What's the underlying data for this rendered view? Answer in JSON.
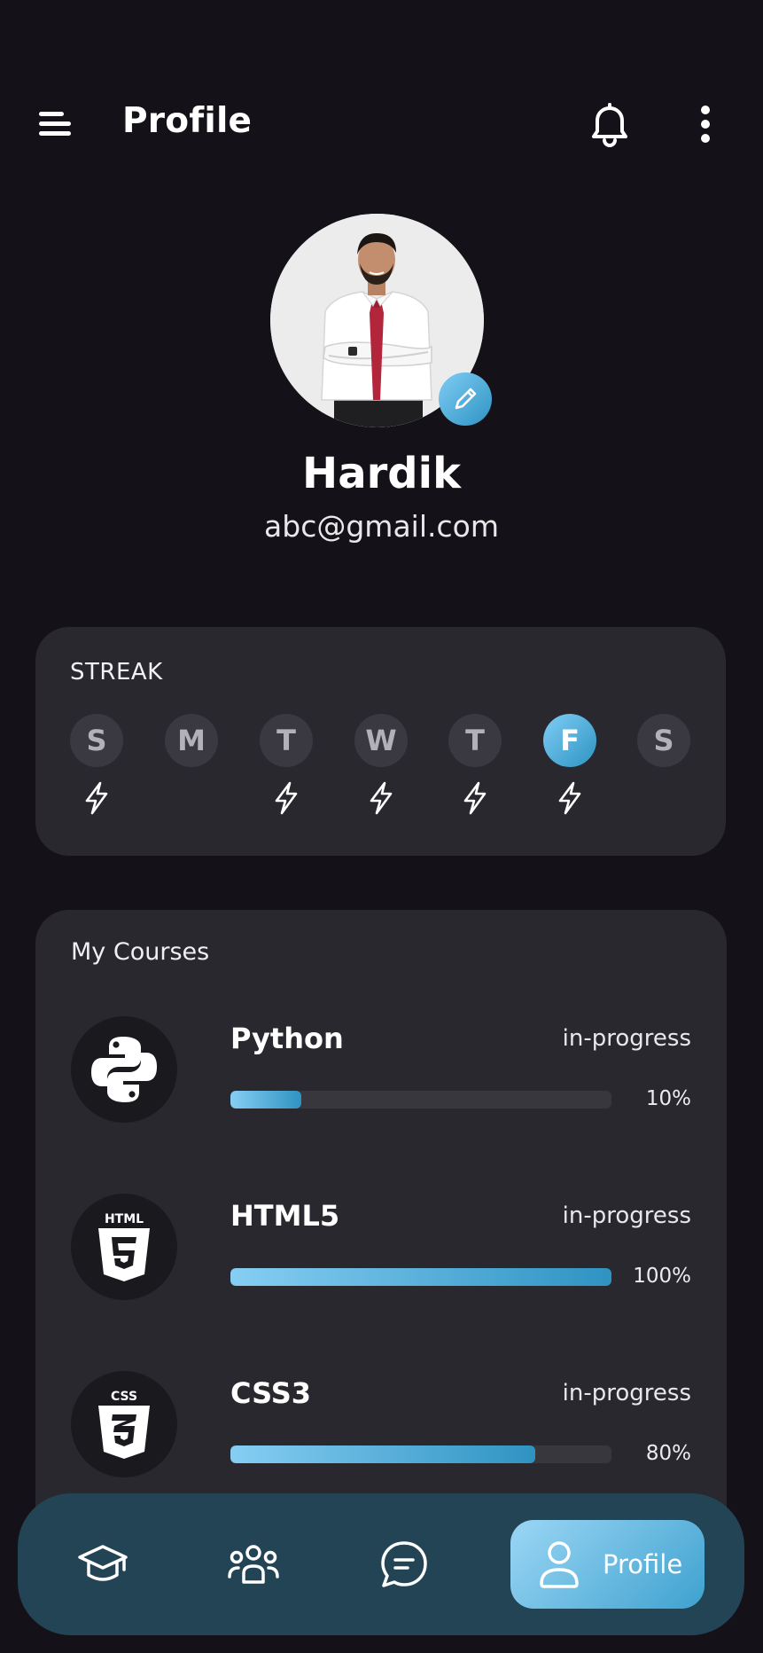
{
  "header": {
    "title": "Profile",
    "menu_icon": "menu-lines-icon",
    "notification_icon": "bell-icon",
    "more_icon": "more-vertical-icon"
  },
  "profile": {
    "name": "Hardik",
    "email": "abc@gmail.com",
    "edit_icon": "pencil-icon"
  },
  "streak": {
    "title": "STREAK",
    "days": [
      {
        "letter": "S",
        "bolt": true,
        "active": false
      },
      {
        "letter": "M",
        "bolt": false,
        "active": false
      },
      {
        "letter": "T",
        "bolt": true,
        "active": false
      },
      {
        "letter": "W",
        "bolt": true,
        "active": false
      },
      {
        "letter": "T",
        "bolt": true,
        "active": false
      },
      {
        "letter": "F",
        "bolt": true,
        "active": true
      },
      {
        "letter": "S",
        "bolt": false,
        "active": false
      }
    ]
  },
  "courses": {
    "title": "My Courses",
    "items": [
      {
        "name": "Python",
        "status": "in-progress",
        "percent_label": "10%",
        "progress": 0.186,
        "icon": "python-icon"
      },
      {
        "name": "HTML5",
        "status": "in-progress",
        "percent_label": "100%",
        "progress": 1.0,
        "icon": "html5-icon"
      },
      {
        "name": "CSS3",
        "status": "in-progress",
        "percent_label": "80%",
        "progress": 0.8,
        "icon": "css3-icon"
      }
    ]
  },
  "bottom_nav": {
    "items": [
      {
        "icon": "graduation-cap-icon"
      },
      {
        "icon": "community-group-icon"
      },
      {
        "icon": "chat-bubble-icon"
      }
    ],
    "active": {
      "label": "Profile",
      "icon": "user-icon"
    }
  },
  "colors": {
    "background": "#141218",
    "card": "#29282f",
    "accent_start": "#7fcdf5",
    "accent_end": "#2f93c2",
    "nav_bar": "#224454"
  }
}
